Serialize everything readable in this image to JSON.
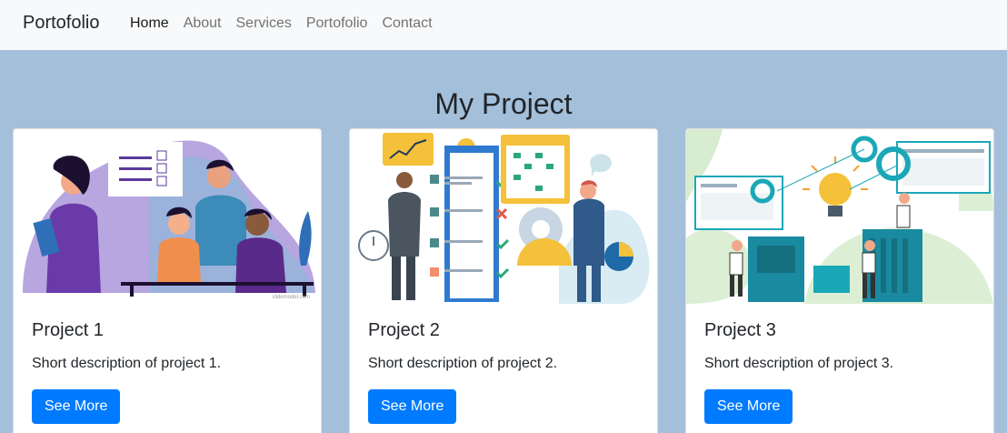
{
  "navbar": {
    "brand": "Portofolio",
    "links": [
      {
        "label": "Home",
        "active": true
      },
      {
        "label": "About",
        "active": false
      },
      {
        "label": "Services",
        "active": false
      },
      {
        "label": "Portofolio",
        "active": false
      },
      {
        "label": "Contact",
        "active": false
      }
    ]
  },
  "section": {
    "title": "My Project"
  },
  "projects": [
    {
      "title": "Project 1",
      "description": "Short description of project 1.",
      "button": "See More",
      "image_credit": "slidemodel.com"
    },
    {
      "title": "Project 2",
      "description": "Short description of project 2.",
      "button": "See More"
    },
    {
      "title": "Project 3",
      "description": "Short description of project 3.",
      "button": "See More"
    }
  ],
  "colors": {
    "page_background": "#a3bfda",
    "navbar_background": "#f8f9fa",
    "button": "#007bff"
  }
}
